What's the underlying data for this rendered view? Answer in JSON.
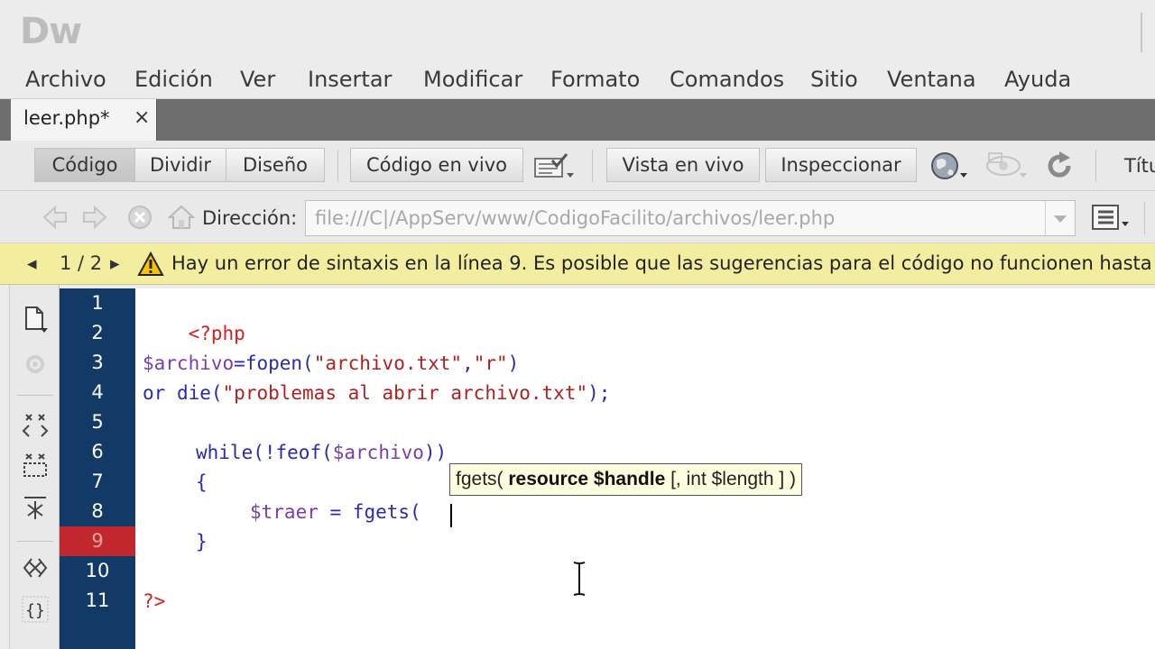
{
  "app": {
    "logo": "Dw"
  },
  "menu": [
    "Archivo",
    "Edición",
    "Ver",
    "Insertar",
    "Modificar",
    "Formato",
    "Comandos",
    "Sitio",
    "Ventana",
    "Ayuda"
  ],
  "document_tab": {
    "label": "leer.php*",
    "close": "×"
  },
  "doc_toolbar": {
    "code": "Código",
    "split": "Dividir",
    "design": "Diseño",
    "live_code": "Código en vivo",
    "live_view": "Vista en vivo",
    "inspect": "Inspeccionar",
    "title_label": "Títu"
  },
  "nav": {
    "address_label": "Dirección:",
    "address_value": "file:///C|/AppServ/www/CodigoFacilito/archivos/leer.php"
  },
  "error_bar": {
    "counter": "1 / 2",
    "message": "Hay un error de sintaxis en la línea 9. Es posible que las sugerencias para el código no funcionen hasta que"
  },
  "gutter": {
    "line_numbers": [
      "1",
      "2",
      "3",
      "4",
      "5",
      "6",
      "7",
      "8",
      "9",
      "10",
      "11"
    ],
    "error_line": 9
  },
  "code": {
    "l1": "<?php",
    "l3a": "$archivo",
    "l3b": "=",
    "l3c": "fopen",
    "l3d": "(",
    "l3e": "\"archivo.txt\"",
    "l3f": ",",
    "l3g": "\"r\"",
    "l3h": ")",
    "l4a": "or ",
    "l4b": "die",
    "l4c": "(",
    "l4d": "\"problemas al abrir archivo.txt\"",
    "l4e": ");",
    "l6a": "while",
    "l6b": "(!",
    "l6c": "feof",
    "l6d": "(",
    "l6e": "$archivo",
    "l6f": "))",
    "l7": "{",
    "l8a": "$traer",
    "l8b": " = ",
    "l8c": "fgets",
    "l8d": "(",
    "l9": "}",
    "l11": "?>"
  },
  "tooltip": {
    "prefix": "fgets( ",
    "bold": "resource $handle",
    "suffix": " [, int $length ] )"
  }
}
